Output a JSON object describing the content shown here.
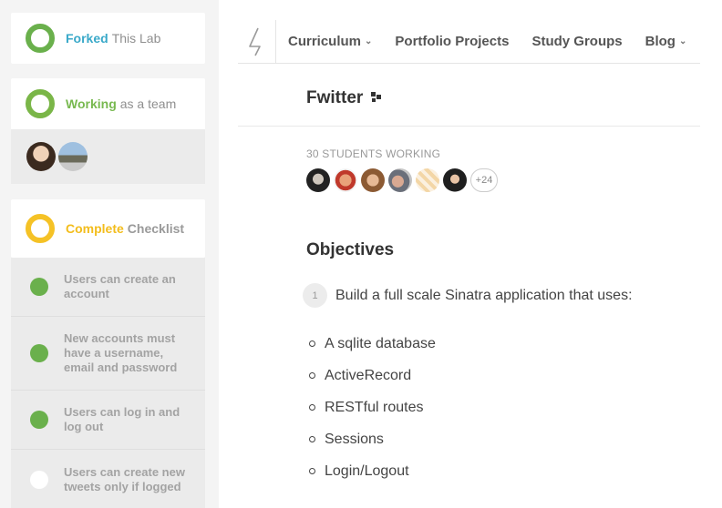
{
  "sidebar": {
    "forked": {
      "strong": "Forked",
      "rest": "This Lab"
    },
    "working": {
      "strong": "Working",
      "rest": "as a team"
    },
    "complete": {
      "strong": "Complete",
      "rest": "Checklist"
    },
    "checklist": [
      {
        "text": "Users can create an account",
        "done": true
      },
      {
        "text": "New accounts must have a username, email and password",
        "done": true
      },
      {
        "text": "Users can log in and log out",
        "done": true
      },
      {
        "text": "Users can create new tweets only if logged",
        "done": false
      }
    ]
  },
  "nav": {
    "items": [
      {
        "label": "Curriculum",
        "dropdown": true
      },
      {
        "label": "Portfolio Projects",
        "dropdown": false
      },
      {
        "label": "Study Groups",
        "dropdown": false
      },
      {
        "label": "Blog",
        "dropdown": true
      }
    ]
  },
  "lab": {
    "title": "Fwitter",
    "students_label": "30 STUDENTS WORKING",
    "more_count": "+24",
    "objectives_heading": "Objectives",
    "step_number": "1",
    "step_text": "Build a full scale Sinatra application that uses:",
    "bullets": [
      "A sqlite database",
      "ActiveRecord",
      "RESTful routes",
      "Sessions",
      "Login/Logout"
    ]
  },
  "colors": {
    "blue": "#3aa9c9",
    "green": "#6ab04c",
    "yellow": "#f5c226"
  }
}
